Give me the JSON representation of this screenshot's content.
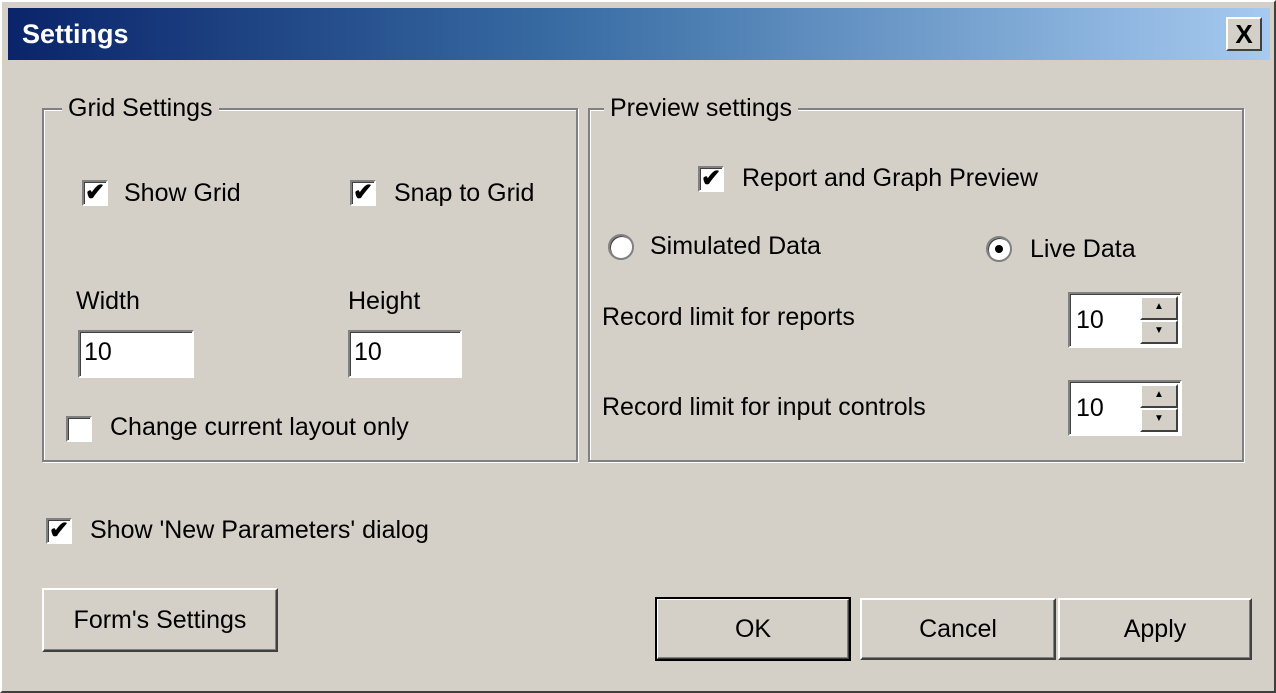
{
  "window": {
    "title": "Settings",
    "close_label": "X"
  },
  "grid_settings": {
    "legend": "Grid Settings",
    "show_grid": {
      "label": "Show Grid",
      "checked": true
    },
    "snap_to_grid": {
      "label": "Snap to Grid",
      "checked": true
    },
    "width": {
      "label": "Width",
      "value": "10"
    },
    "height": {
      "label": "Height",
      "value": "10"
    },
    "change_current_layout_only": {
      "label": "Change current layout only",
      "checked": false
    }
  },
  "preview_settings": {
    "legend": "Preview settings",
    "report_graph_preview": {
      "label": "Report and Graph Preview",
      "checked": true
    },
    "simulated_data": {
      "label": "Simulated Data",
      "selected": false
    },
    "live_data": {
      "label": "Live Data",
      "selected": true
    },
    "record_limit_reports": {
      "label": "Record limit for reports",
      "value": "10"
    },
    "record_limit_input_controls": {
      "label": "Record limit for input controls",
      "value": "10"
    }
  },
  "show_new_parameters_dialog": {
    "label": "Show 'New Parameters' dialog",
    "checked": true
  },
  "buttons": {
    "forms_settings": "Form's Settings",
    "ok": "OK",
    "cancel": "Cancel",
    "apply": "Apply"
  },
  "icons": {
    "check": "✔",
    "spin_up": "▲",
    "spin_down": "▼"
  }
}
